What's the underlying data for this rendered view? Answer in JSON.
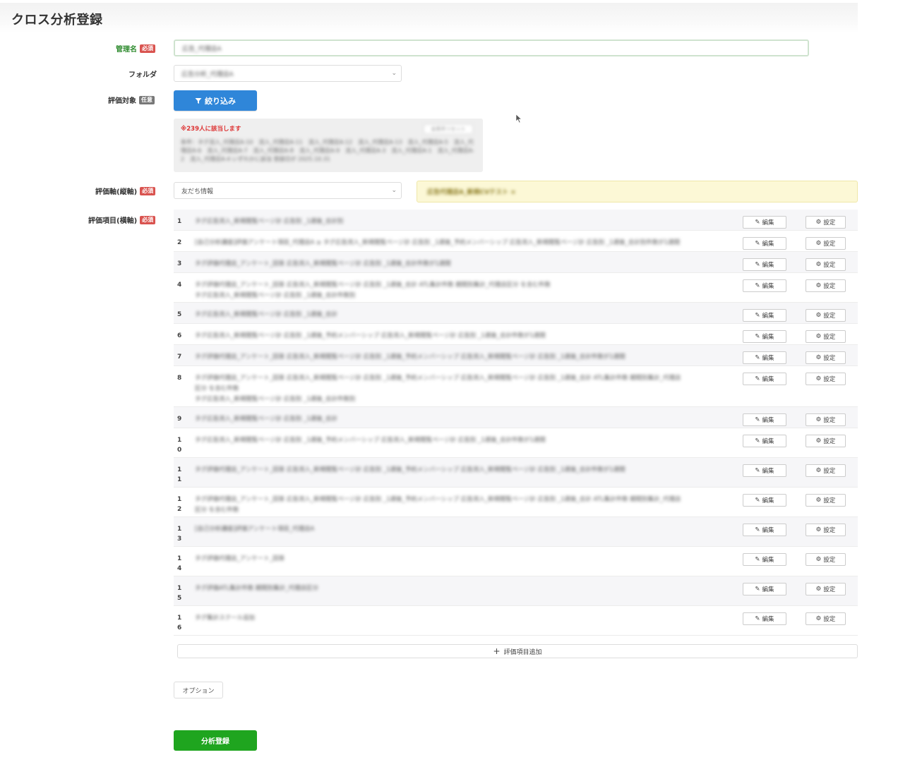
{
  "page": {
    "title": "クロス分析登録"
  },
  "form": {
    "name_label": "管理名",
    "name_value": "広告_代理店A",
    "folder_label": "フォルダ",
    "folder_value": "広告分析_代理店A",
    "target_label": "評価対象",
    "required_badge": "必須",
    "optional_badge": "任意",
    "filter_button": "絞り込み",
    "filter_count": "※239人に該当します",
    "filter_reset": "全条件リセット",
    "filter_desc": "条件：タグ流入_代理店A-10　流入_代理店A-11　流入_代理店A-12　流入_代理店A-13　流入_代理店A-5　流入_代理店A-6　流入_代理店A-7　流入_代理店A-8　流入_代理店A-9　流入_代理店A-3　流入_代理店A-1　流入_代理店A-2　流入_代理店A-4 いずれかに該当 登録日が 2025.10.31",
    "axis_label": "評価軸(縦軸)",
    "axis_value": "友だち情報",
    "axis_note": "広告代理店A_新規CVテスト ×",
    "items_label": "評価項目(横軸)",
    "items": [
      {
        "num": "1",
        "text": "タグ広告流入_新規閲覧ページ計 広告別 _1週後_合計別"
      },
      {
        "num": "2",
        "text": "[自己分析講座]評価アンケート項目_代理店A ≥ タグ広告流入_新規閲覧ページ計 広告別 _1週後_予約メンバーシップ 広告流入_新規閲覧ページ計 広告別 _1週後_合計別件数が1週間"
      },
      {
        "num": "3",
        "text": "タグ評価代理店_アンケート_回答 広告流入_新規閲覧ページ計 広告別 _1週後_合計件数が1週間"
      },
      {
        "num": "4",
        "text": "タグ評価代理店_アンケート_回答 広告流入_新規閲覧ページ計 広告別 _1週後_合計 ATL集計件数 期間別集計_代理店区分 を含む件数\nタグ広告流入_新規閲覧ページ計 広告別 _1週後_合計件数別"
      },
      {
        "num": "5",
        "text": "タグ広告流入_新規閲覧ページ計 広告別 _1週後_合計"
      },
      {
        "num": "6",
        "text": "タグ広告流入_新規閲覧ページ計 広告別 _1週後_予約メンバーシップ 広告流入_新規閲覧ページ計 広告別 _1週後_合計件数が1週間"
      },
      {
        "num": "7",
        "text": "タグ評価代理店_アンケート_回答 広告流入_新規閲覧ページ計 広告別 _1週後_予約メンバーシップ 広告流入_新規閲覧ページ計 広告別 _1週後_合計件数が1週間"
      },
      {
        "num": "8",
        "text": "タグ評価代理店_アンケート_回答 広告流入_新規閲覧ページ計 広告別 _1週後_予約メンバーシップ 広告流入_新規閲覧ページ計 広告別 _1週後_合計 ATL集計件数 期間別集計_代理店\n区分 を含む件数\nタグ広告流入_新規閲覧ページ計 広告別 _1週後_合計件数別"
      },
      {
        "num": "9",
        "text": "タグ広告流入_新規閲覧ページ計 広告別 _1週後_合計"
      },
      {
        "num": "10",
        "text": "タグ広告流入_新規閲覧ページ計 広告別 _1週後_予約メンバーシップ 広告流入_新規閲覧ページ計 広告別 _1週後_合計件数が1週間"
      },
      {
        "num": "11",
        "text": "タグ評価代理店_アンケート_回答 広告流入_新規閲覧ページ計 広告別 _1週後_予約メンバーシップ 広告流入_新規閲覧ページ計 広告別 _1週後_合計件数が1週間"
      },
      {
        "num": "12",
        "text": "タグ評価代理店_アンケート_回答 広告流入_新規閲覧ページ計 広告別 _1週後_予約メンバーシップ 広告流入_新規閲覧ページ計 広告別 _1週後_合計 ATL集計件数 期間別集計_代理店\n区分 を含む件数"
      },
      {
        "num": "13",
        "text": "[自己分析講座]評価アンケート項目_代理店A"
      },
      {
        "num": "14",
        "text": "タグ評価代理店_アンケート_回答"
      },
      {
        "num": "15",
        "text": "タグ評価ATL集計件数 期間別集計_代理店区分"
      },
      {
        "num": "16",
        "text": "タグ集計スクール追加"
      }
    ],
    "edit_label": "編集",
    "settings_label": "設定",
    "add_item_label": "評価項目追加",
    "option_button": "オプション",
    "submit_button": "分析登録"
  }
}
